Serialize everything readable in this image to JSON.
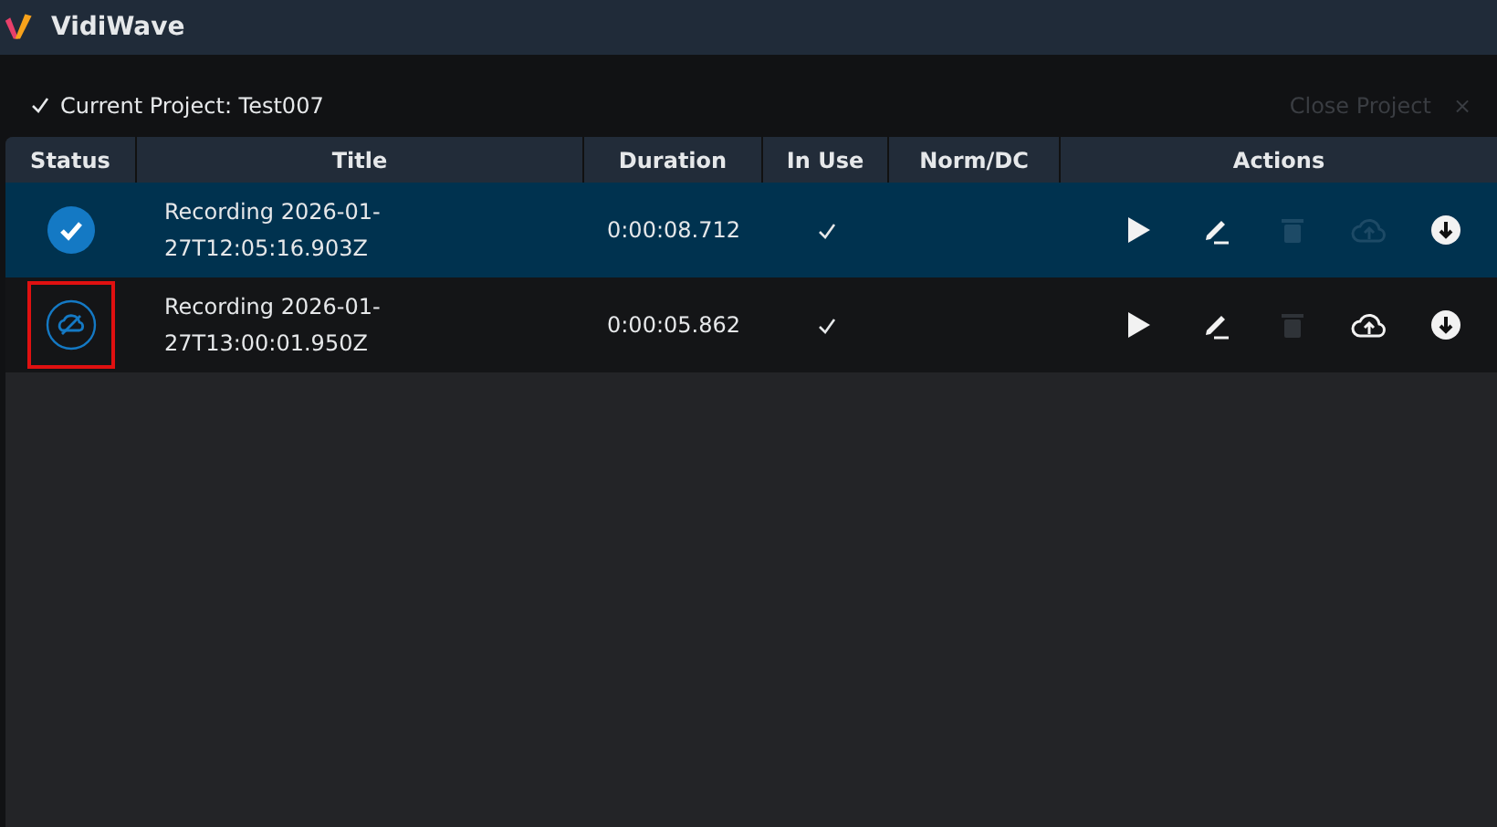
{
  "app": {
    "title": "VidiWave"
  },
  "project": {
    "label": "Current Project: Test007",
    "close_label": "Close Project",
    "close_icon": "×",
    "close_disabled": true
  },
  "table": {
    "columns": [
      "Status",
      "Title",
      "Duration",
      "In Use",
      "Norm/DC",
      "Actions"
    ],
    "rows": [
      {
        "selected": true,
        "synced": true,
        "highlighted": false,
        "title": "Recording 2026-01-27T12:05:16.903Z",
        "duration": "0:00:08.712",
        "in_use": true,
        "actions": [
          {
            "kind": "play",
            "disabled": false
          },
          {
            "kind": "edit",
            "disabled": false
          },
          {
            "kind": "delete",
            "disabled": true
          },
          {
            "kind": "upload",
            "disabled": true
          },
          {
            "kind": "download",
            "disabled": false
          }
        ]
      },
      {
        "selected": false,
        "synced": false,
        "highlighted": true,
        "title": "Recording 2026-01-27T13:00:01.950Z",
        "duration": "0:00:05.862",
        "in_use": true,
        "actions": [
          {
            "kind": "play",
            "disabled": false
          },
          {
            "kind": "edit",
            "disabled": false
          },
          {
            "kind": "delete",
            "disabled": true
          },
          {
            "kind": "upload",
            "disabled": false
          },
          {
            "kind": "download",
            "disabled": false
          }
        ]
      }
    ]
  }
}
